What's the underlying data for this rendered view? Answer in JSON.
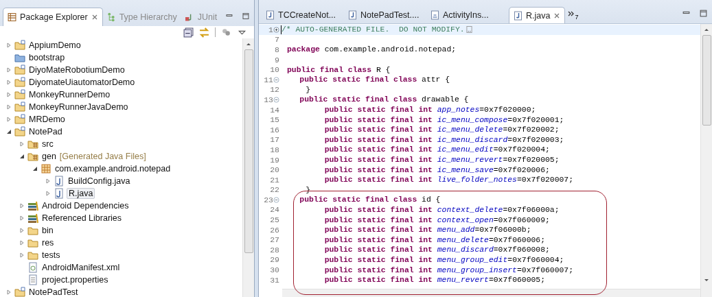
{
  "explorer": {
    "tabs": [
      {
        "label": "Package Explorer",
        "kind": "packages",
        "selected": true
      },
      {
        "label": "Type Hierarchy",
        "kind": "hierarchy",
        "selected": false
      },
      {
        "label": "JUnit",
        "kind": "junit",
        "selected": false
      }
    ],
    "tree": [
      {
        "label": "AppiumDemo",
        "kind": "project",
        "expanded": false,
        "selected": false
      },
      {
        "label": "bootstrap",
        "kind": "folder",
        "selected": false
      },
      {
        "label": "DiyoMateRobotiumDemo",
        "kind": "project",
        "expanded": false,
        "selected": false
      },
      {
        "label": "DiyomateUiautomatorDemo",
        "kind": "project",
        "expanded": false,
        "selected": false
      },
      {
        "label": "MonkeyRunnerDemo",
        "kind": "project",
        "expanded": false,
        "selected": false
      },
      {
        "label": "MonkeyRunnerJavaDemo",
        "kind": "project",
        "expanded": false,
        "selected": false
      },
      {
        "label": "MRDemo",
        "kind": "project",
        "expanded": false,
        "selected": false
      },
      {
        "label": "NotePad",
        "kind": "project",
        "expanded": true,
        "selected": false,
        "children": [
          {
            "label": "src",
            "kind": "source",
            "expanded": false,
            "selected": false
          },
          {
            "label": "gen",
            "decoration": "[Generated Java Files]",
            "kind": "source",
            "expanded": true,
            "selected": false,
            "children": [
              {
                "label": "com.example.android.notepad",
                "kind": "package",
                "expanded": true,
                "selected": false,
                "children": [
                  {
                    "label": "BuildConfig.java",
                    "kind": "java",
                    "expanded": false,
                    "selected": false
                  },
                  {
                    "label": "R.java",
                    "kind": "java",
                    "expanded": false,
                    "selected": true
                  }
                ]
              }
            ]
          },
          {
            "label": "Android Dependencies",
            "kind": "library",
            "expanded": false,
            "selected": false
          },
          {
            "label": "Referenced Libraries",
            "kind": "library",
            "expanded": false,
            "selected": false
          },
          {
            "label": "bin",
            "kind": "folder",
            "expanded": false,
            "selected": false
          },
          {
            "label": "res",
            "kind": "folder",
            "expanded": false,
            "selected": false
          },
          {
            "label": "tests",
            "kind": "folder",
            "expanded": false,
            "selected": false
          },
          {
            "label": "AndroidManifest.xml",
            "kind": "xml",
            "selected": false
          },
          {
            "label": "project.properties",
            "kind": "text",
            "selected": false
          }
        ]
      },
      {
        "label": "NotePadTest",
        "kind": "project",
        "expanded": false,
        "selected": false
      }
    ]
  },
  "editor": {
    "tabs": [
      {
        "label": "TCCreateNot...",
        "kind": "java",
        "selected": false
      },
      {
        "label": "NotePadTest....",
        "kind": "java",
        "selected": false
      },
      {
        "label": "ActivityIns...",
        "kind": "class",
        "selected": false
      },
      {
        "label": "R.java",
        "kind": "java",
        "selected": true
      }
    ],
    "overflow_count": "7",
    "lines": [
      {
        "number": "1",
        "kind": "comment",
        "text": "/* AUTO-GENERATED FILE.  DO NOT MODIFY.",
        "collapsed": true,
        "current": true
      },
      {
        "number": "7",
        "kind": "code",
        "current": false
      },
      {
        "number": "8",
        "kind": "code",
        "text": "**package** com.example.android.notepad;",
        "current": false
      },
      {
        "number": "9",
        "kind": "code",
        "current": false
      },
      {
        "number": "10",
        "kind": "code",
        "text": "**public final class** R {",
        "current": false
      },
      {
        "number": "11",
        "kind": "code",
        "text": "    **public static final class** attr {",
        "collapsed": false,
        "current": false
      },
      {
        "number": "12",
        "kind": "code",
        "text": "    }",
        "current": false
      },
      {
        "number": "13",
        "kind": "code",
        "text": "    **public static final class** drawable {",
        "collapsed": false,
        "current": false
      },
      {
        "number": "14",
        "kind": "code",
        "text": "        **public static final int** *app_notes*=0x7f020000;",
        "current": false
      },
      {
        "number": "15",
        "kind": "code",
        "text": "        **public static final int** *ic_menu_compose*=0x7f020001;",
        "current": false
      },
      {
        "number": "16",
        "kind": "code",
        "text": "        **public static final int** *ic_menu_delete*=0x7f020002;",
        "current": false
      },
      {
        "number": "17",
        "kind": "code",
        "text": "        **public static final int** *ic_menu_discard*=0x7f020003;",
        "current": false
      },
      {
        "number": "18",
        "kind": "code",
        "text": "        **public static final int** *ic_menu_edit*=0x7f020004;",
        "current": false
      },
      {
        "number": "19",
        "kind": "code",
        "text": "        **public static final int** *ic_menu_revert*=0x7f020005;",
        "current": false
      },
      {
        "number": "20",
        "kind": "code",
        "text": "        **public static final int** *ic_menu_save*=0x7f020006;",
        "current": false
      },
      {
        "number": "21",
        "kind": "code",
        "text": "        **public static final int** *live_folder_notes*=0x7f020007;",
        "current": false
      },
      {
        "number": "22",
        "kind": "code",
        "text": "    }",
        "current": false
      },
      {
        "number": "23",
        "kind": "code",
        "text": "    **public static final class** id {",
        "collapsed": false,
        "current": false
      },
      {
        "number": "24",
        "kind": "code",
        "text": "        **public static final int** *context_delete*=0x7f06000a;",
        "current": false
      },
      {
        "number": "25",
        "kind": "code",
        "text": "        **public static final int** *context_open*=0x7f060009;",
        "current": false
      },
      {
        "number": "26",
        "kind": "code",
        "text": "        **public static final int** *menu_add*=0x7f06000b;",
        "current": false
      },
      {
        "number": "27",
        "kind": "code",
        "text": "        **public static final int** *menu_delete*=0x7f060006;",
        "current": false
      },
      {
        "number": "28",
        "kind": "code",
        "text": "        **public static final int** *menu_discard*=0x7f060008;",
        "current": false
      },
      {
        "number": "29",
        "kind": "code",
        "text": "        **public static final int** *menu_group_edit*=0x7f060004;",
        "current": false
      },
      {
        "number": "30",
        "kind": "code",
        "text": "        **public static final int** *menu_group_insert*=0x7f060007;",
        "current": false
      },
      {
        "number": "31",
        "kind": "code",
        "text": "        **public static final int** *menu_revert*=0x7f060005;",
        "current": false
      }
    ]
  }
}
